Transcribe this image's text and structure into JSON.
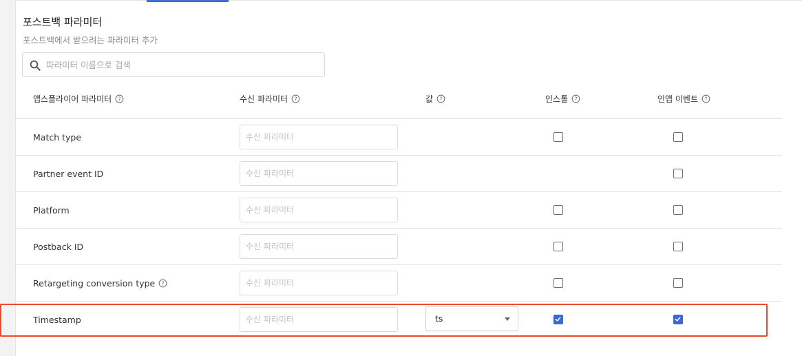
{
  "section": {
    "title": "포스트백 파라미터",
    "subtitle": "포스트백에서 받으려는 파라미터 추가"
  },
  "search": {
    "placeholder": "파라미터 이름으로 검색",
    "value": ""
  },
  "columns": {
    "appsflyer_param": "앱스플라이어 파라미터",
    "receive_param": "수신 파라미터",
    "value": "값",
    "install": "인스톨",
    "inapp_event": "인앱 이벤트"
  },
  "rows": [
    {
      "name": "Match type",
      "receive_placeholder": "수신 파라미터",
      "value": "",
      "install": false,
      "inapp": false,
      "has_help": false,
      "show_install": true
    },
    {
      "name": "Partner event ID",
      "receive_placeholder": "수신 파라미터",
      "value": "",
      "install": false,
      "inapp": false,
      "has_help": false,
      "show_install": false
    },
    {
      "name": "Platform",
      "receive_placeholder": "수신 파라미터",
      "value": "",
      "install": false,
      "inapp": false,
      "has_help": false,
      "show_install": true
    },
    {
      "name": "Postback ID",
      "receive_placeholder": "수신 파라미터",
      "value": "",
      "install": false,
      "inapp": false,
      "has_help": false,
      "show_install": true
    },
    {
      "name": "Retargeting conversion type",
      "receive_placeholder": "수신 파라미터",
      "value": "",
      "install": false,
      "inapp": false,
      "has_help": true,
      "show_install": true
    },
    {
      "name": "Timestamp",
      "receive_placeholder": "수신 파라미터",
      "value": "ts",
      "install": true,
      "inapp": true,
      "has_help": false,
      "show_install": true
    }
  ],
  "colors": {
    "accent": "#3b68d6",
    "highlight": "#ee4a2a"
  }
}
